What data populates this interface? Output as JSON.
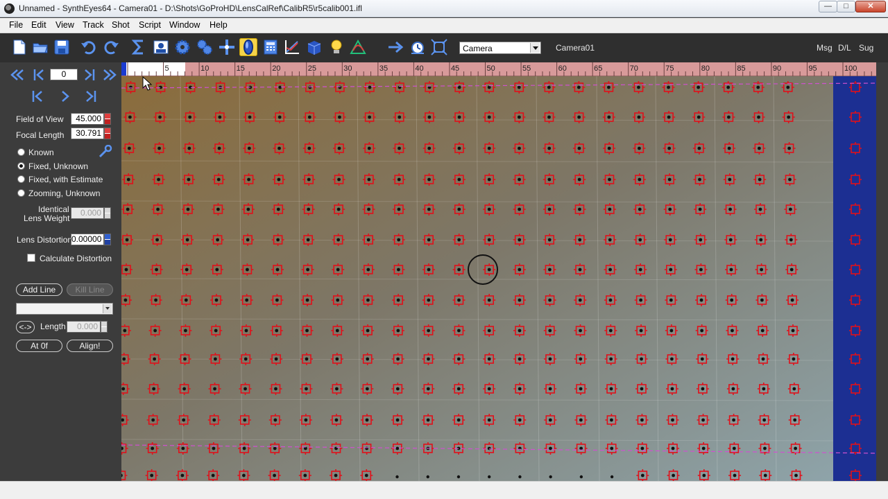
{
  "window": {
    "title": "Unnamed - SynthEyes64 - Camera01 - D:\\Shots\\GoProHD\\LensCalRef\\CalibR5\\r5calib001.ifl",
    "minimize_glyph": "—",
    "maximize_glyph": "□",
    "close_glyph": "✕"
  },
  "menu": [
    "File",
    "Edit",
    "View",
    "Track",
    "Shot",
    "Script",
    "Window",
    "Help"
  ],
  "toolbar": {
    "icons": [
      "new-file-icon",
      "open-folder-icon",
      "save-icon",
      "undo-icon",
      "redo-icon",
      "sigma-solver-icon",
      "camera-view-icon",
      "gear-icon",
      "multi-gear-icon",
      "coordinate-axes-icon",
      "lens-icon",
      "calculator-icon",
      "graph-editor-icon",
      "3d-cube-icon",
      "lightbulb-icon",
      "phase-icon",
      "arrow-right-icon",
      "stopwatch-icon",
      "fit-frame-icon"
    ],
    "active_icon": "lens-icon",
    "camera_select": "Camera",
    "camera_name": "Camera01",
    "right_links": [
      "Msg",
      "D/L",
      "Sug"
    ]
  },
  "playback": {
    "frame": "0"
  },
  "lens_panel": {
    "fov_label": "Field of View",
    "fov_value": "45.000",
    "focal_label": "Focal Length",
    "focal_value": "30.791",
    "modes": [
      "Known",
      "Fixed, Unknown",
      "Fixed, with Estimate",
      "Zooming, Unknown"
    ],
    "selected_mode": 1,
    "identical_label_1": "Identical",
    "identical_label_2": "Lens Weight",
    "identical_value": "0.000",
    "distortion_label": "Lens Distortion",
    "distortion_value": "0.00000",
    "calc_distortion_label": "Calculate Distortion",
    "calc_distortion_checked": false,
    "add_line": "Add Line",
    "kill_line": "Kill Line",
    "length_toggle": "<->",
    "length_label": "Length",
    "length_value": "0.000",
    "at0f": "At 0f",
    "align": "Align!"
  },
  "timeline": {
    "ticks": [
      "5",
      "10",
      "15",
      "20",
      "25",
      "30",
      "35",
      "40",
      "45",
      "50",
      "55",
      "60",
      "65",
      "70",
      "75",
      "80",
      "85",
      "90",
      "95",
      "100"
    ]
  },
  "colors": {
    "tracker": "#e0101a",
    "timeline": "#d89a9a",
    "panel": "#3c3c3c",
    "selected_strip": "#1c2f92",
    "guide_line": "#d050d0"
  }
}
